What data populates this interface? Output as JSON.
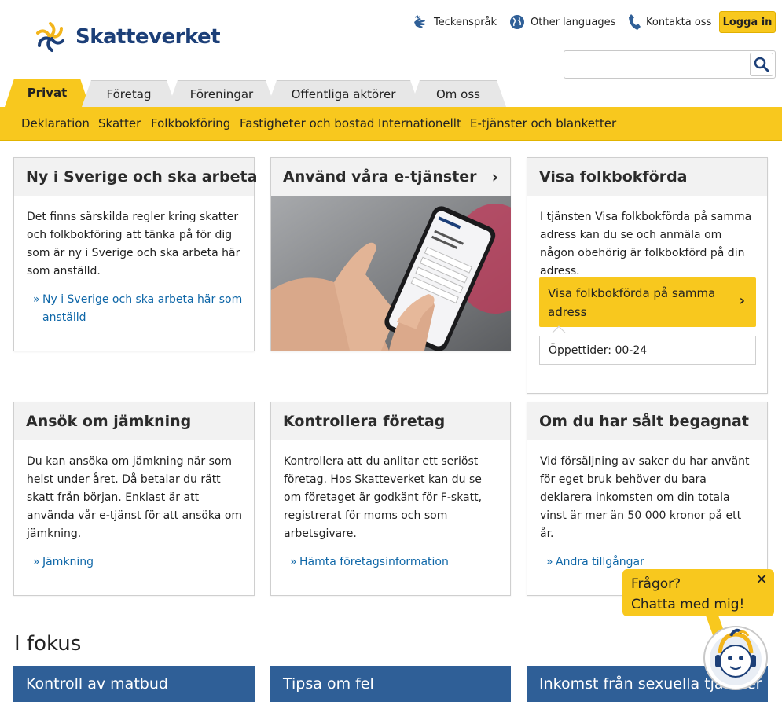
{
  "header": {
    "logo_text": "Skatteverket",
    "top_links": [
      {
        "label": "Teckenspråk",
        "icon": "sign-language-icon"
      },
      {
        "label": "Other languages",
        "icon": "globe-icon"
      },
      {
        "label": "Kontakta oss",
        "icon": "phone-icon"
      }
    ],
    "login_label": "Logga in",
    "search": {
      "value": "",
      "placeholder": "",
      "icon": "search-icon"
    }
  },
  "tabs": [
    "Privat",
    "Företag",
    "Föreningar",
    "Offentliga aktörer",
    "Om oss"
  ],
  "active_tab": "Privat",
  "nav": [
    "Deklaration",
    "Skatter",
    "Folkbokföring",
    "Fastigheter och bostad",
    "Internationellt",
    "E-tjänster och blanketter"
  ],
  "cards": [
    {
      "title": "Ny i Sverige och ska arbeta",
      "text": "Det finns särskilda regler kring skatter och folkbokföring att tänka på för dig som är ny i Sverige och ska arbeta här som anställd.",
      "link": "Ny i Sverige och ska arbeta här som anställd"
    },
    {
      "title": "Använd våra e-tjänster",
      "chevron": "›",
      "image": "hand-holding-phone-image"
    },
    {
      "title": "Visa folkbokförda",
      "text": "I tjänsten Visa folkbokförda på samma adress kan du se och anmäla om någon obehörig är folkbokförd på din adress.",
      "button": "Visa folkbokförda på samma adress",
      "button_chevron": "›",
      "hours": "Öppettider: 00-24"
    },
    {
      "title": "Ansök om jämkning",
      "text": "Du kan ansöka om jämkning när som helst under året. Då betalar du rätt skatt från början. Enklast är att använda vår e-tjänst för att ansöka om jämkning.",
      "link": "Jämkning"
    },
    {
      "title": "Kontrollera företag",
      "text": "Kontrollera att du anlitar ett seriöst företag. Hos Skatteverket kan du se om företaget är godkänt för F-skatt, registrerat för moms och som arbetsgivare.",
      "link": "Hämta företagsinformation"
    },
    {
      "title": "Om du har sålt begagnat",
      "text": "Vid försäljning av saker du har använt för eget bruk behöver du bara deklarera inkomsten om din totala vinst är mer än 50 000 kronor på ett år.",
      "link": "Andra tillgångar"
    }
  ],
  "link_arrow": "»",
  "fokus": {
    "title": "I fokus",
    "items": [
      "Kontroll av matbud",
      "Tipsa om fel",
      "Inkomst från sexuella tjänster"
    ]
  },
  "chat": {
    "line1": "Frågor?",
    "line2": "Chatta med mig!",
    "close": "✕",
    "avatar": "chatbot-avatar-icon"
  },
  "colors": {
    "accent": "#f8c81e",
    "brand_blue": "#1c3f78",
    "link": "#0f67a8",
    "fokus_blue": "#2f5f97"
  }
}
